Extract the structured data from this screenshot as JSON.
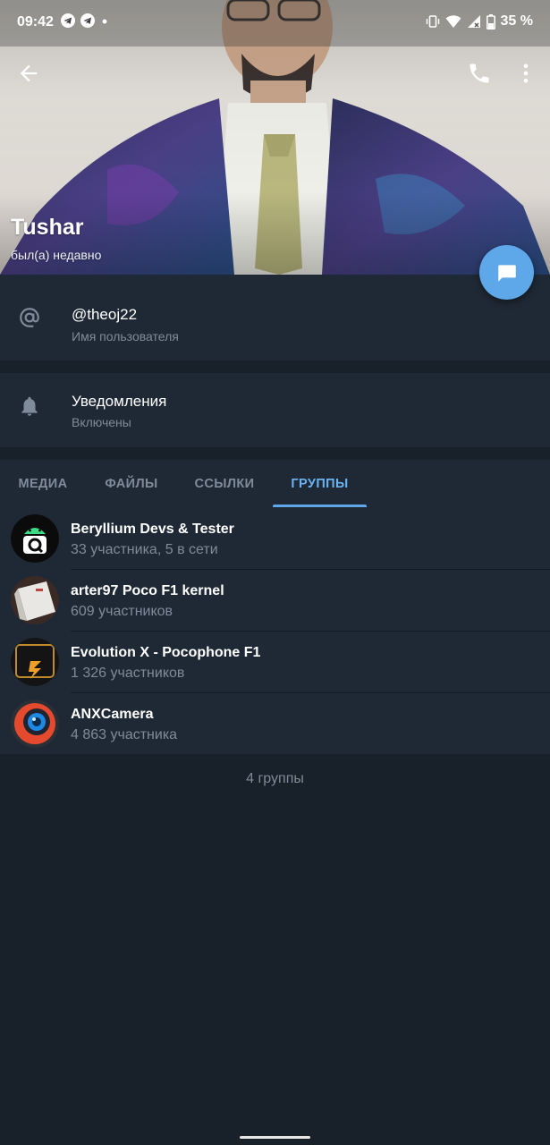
{
  "status_bar": {
    "time": "09:42",
    "left_icons": [
      "telegram-icon",
      "telegram-icon",
      "dot-icon"
    ],
    "right_icons": [
      "vibrate-icon",
      "wifi-icon",
      "signal-icon",
      "battery-icon"
    ],
    "battery": "35 %"
  },
  "header": {
    "back_icon": "back-arrow-icon",
    "actions": [
      "phone-icon",
      "more-vert-icon"
    ]
  },
  "profile": {
    "name": "Tushar",
    "status": "был(а) недавно",
    "fab_icon": "message-icon"
  },
  "info": {
    "username": {
      "icon": "at-sign-icon",
      "value": "@theoj22",
      "label": "Имя пользователя"
    },
    "notifications": {
      "icon": "bell-icon",
      "value": "Уведомления",
      "label": "Включены"
    }
  },
  "tabs": [
    {
      "label": "МЕДИА",
      "active": false
    },
    {
      "label": "ФАЙЛЫ",
      "active": false
    },
    {
      "label": "ССЫЛКИ",
      "active": false
    },
    {
      "label": "ГРУППЫ",
      "active": true
    }
  ],
  "groups": [
    {
      "title": "Beryllium Devs & Tester",
      "subtitle": "33 участника, 5 в сети"
    },
    {
      "title": "arter97 Poco F1 kernel",
      "subtitle": "609 участников"
    },
    {
      "title": "Evolution X - Pocophone F1",
      "subtitle": "1 326 участников"
    },
    {
      "title": "ANXCamera",
      "subtitle": "4 863 участника"
    }
  ],
  "groups_count": "4 группы",
  "colors": {
    "background": "#18202a",
    "surface": "#1f2935",
    "accent": "#5ea7e8",
    "secondary_text": "#7f8b98"
  }
}
